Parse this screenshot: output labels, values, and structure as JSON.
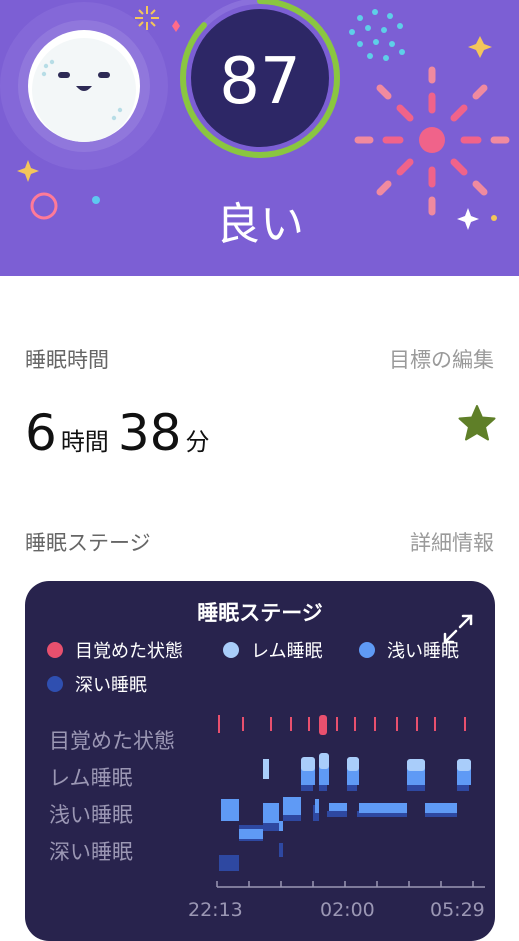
{
  "score": {
    "value": "87",
    "label": "良い",
    "ring_fraction": 0.87,
    "ring_color": "#8ac640"
  },
  "duration_section": {
    "title": "睡眠時間",
    "edit_link": "目標の編集",
    "hours": "6",
    "hours_unit": "時間",
    "minutes": "38",
    "minutes_unit": "分",
    "goal_icon": "star-icon",
    "goal_icon_color": "#5f7f28"
  },
  "stages_section": {
    "title": "睡眠ステージ",
    "details_link": "詳細情報"
  },
  "card": {
    "title": "睡眠ステージ",
    "expand_icon": "expand-icon",
    "legend": [
      {
        "label": "目覚めた状態",
        "color": "#e8506e"
      },
      {
        "label": "レム睡眠",
        "color": "#a9cdfa"
      },
      {
        "label": "浅い睡眠",
        "color": "#5f9af5"
      },
      {
        "label": "深い睡眠",
        "color": "#2f4fb0"
      }
    ],
    "stage_labels": [
      "目覚めた状態",
      "レム睡眠",
      "浅い睡眠",
      "深い睡眠"
    ],
    "time_labels": [
      "22:13",
      "02:00",
      "05:29"
    ]
  },
  "colors": {
    "hero_bg": "#7c5fd4",
    "card_bg": "#28234d"
  }
}
